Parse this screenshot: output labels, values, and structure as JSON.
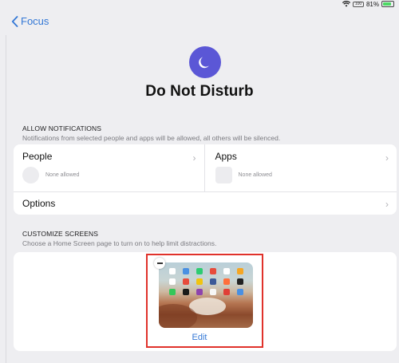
{
  "status": {
    "battery_box": "100",
    "battery_percent": "81%"
  },
  "nav": {
    "back_label": "Focus"
  },
  "header": {
    "title": "Do Not Disturb"
  },
  "allow_notifications": {
    "title": "ALLOW NOTIFICATIONS",
    "subtitle": "Notifications from selected people and apps will be allowed, all others will be silenced.",
    "people": {
      "label": "People",
      "value": "None allowed"
    },
    "apps": {
      "label": "Apps",
      "value": "None allowed"
    },
    "options_label": "Options"
  },
  "customize_screens": {
    "title": "CUSTOMIZE SCREENS",
    "subtitle": "Choose a Home Screen page to turn on to help limit distractions.",
    "edit_label": "Edit"
  },
  "colors": {
    "accent": "#3478d6",
    "focus_icon": "#5b57d6",
    "highlight_frame": "#e0322b",
    "app_icons": [
      "#ffffff",
      "#4a90e2",
      "#2ecc71",
      "#e74c3c",
      "#ffffff",
      "#f5a623",
      "#ffffff",
      "#e74c3c",
      "#f1c40f",
      "#3b5998",
      "#ff6f3c",
      "#222222",
      "#34c759",
      "#1a1a1a",
      "#8e44ad",
      "#f7f7f7",
      "#e03e36",
      "#4a90e2"
    ]
  }
}
